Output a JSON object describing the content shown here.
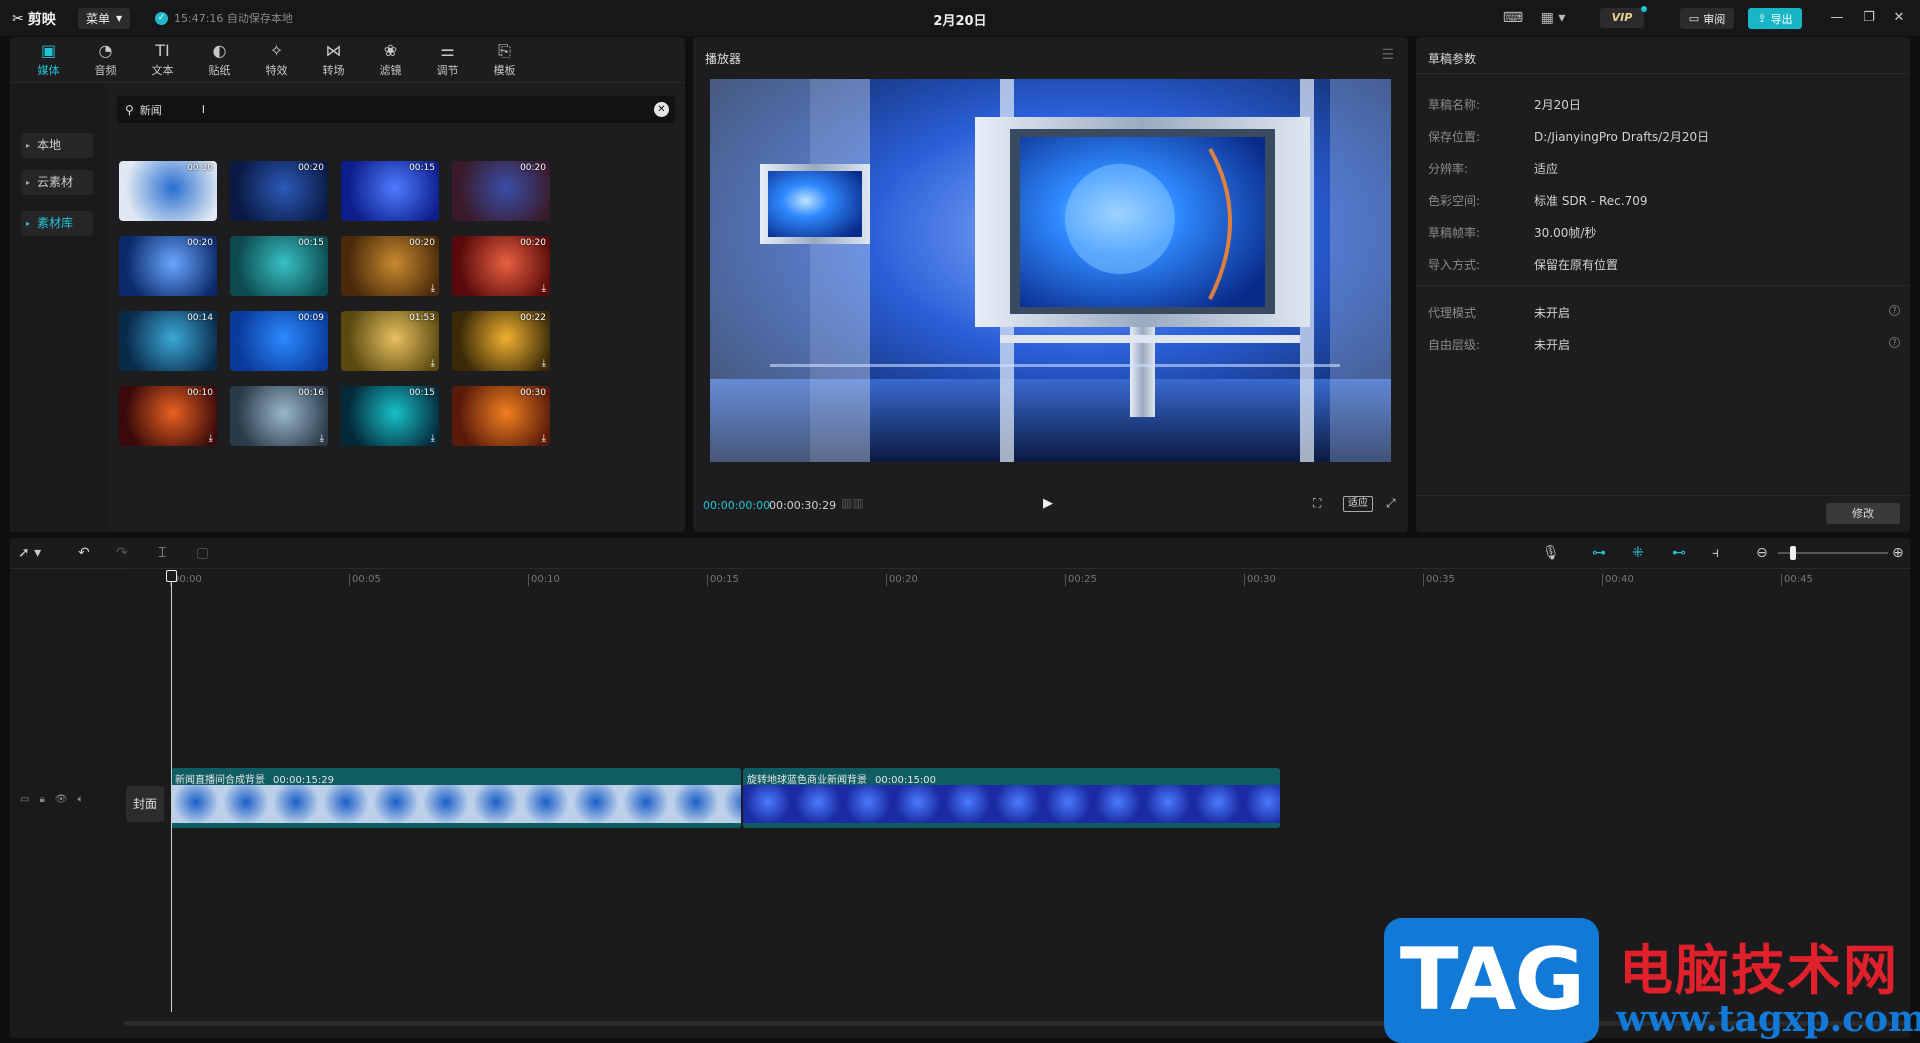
{
  "app": {
    "name": "剪映",
    "menu_label": "菜单",
    "autosave": "15:47:16 自动保存本地",
    "doc_title": "2月20日",
    "vip_label": "VIP",
    "review_label": "审阅",
    "export_label": "导出"
  },
  "media": {
    "tabs": [
      {
        "label": "媒体",
        "icon": "media-icon"
      },
      {
        "label": "音频",
        "icon": "audio-icon"
      },
      {
        "label": "文本",
        "icon": "text-icon"
      },
      {
        "label": "贴纸",
        "icon": "sticker-icon"
      },
      {
        "label": "特效",
        "icon": "effects-icon"
      },
      {
        "label": "转场",
        "icon": "transition-icon"
      },
      {
        "label": "滤镜",
        "icon": "filter-icon"
      },
      {
        "label": "调节",
        "icon": "adjust-icon"
      },
      {
        "label": "模板",
        "icon": "template-icon"
      }
    ],
    "sidebar": [
      {
        "label": "本地"
      },
      {
        "label": "云素材"
      },
      {
        "label": "素材库"
      }
    ],
    "search_value": "新闻",
    "thumbnails": [
      {
        "dur": "00:30",
        "download": false,
        "c1": "#dfe8f3",
        "c2": "#2a6fd0"
      },
      {
        "dur": "00:20",
        "download": false,
        "c1": "#0a1a44",
        "c2": "#2b5ab8"
      },
      {
        "dur": "00:15",
        "download": false,
        "c1": "#0d1d8a",
        "c2": "#4d7bff"
      },
      {
        "dur": "00:20",
        "download": false,
        "c1": "#3a1a2a",
        "c2": "#3a4fa8"
      },
      {
        "dur": "00:20",
        "download": false,
        "c1": "#0a2a6a",
        "c2": "#6aa6ff"
      },
      {
        "dur": "00:15",
        "download": false,
        "c1": "#0c4a4e",
        "c2": "#38c0c4"
      },
      {
        "dur": "00:20",
        "download": true,
        "c1": "#4a2a0a",
        "c2": "#c88a30"
      },
      {
        "dur": "00:20",
        "download": true,
        "c1": "#5a0a0a",
        "c2": "#e86040"
      },
      {
        "dur": "00:14",
        "download": false,
        "c1": "#0a2a4a",
        "c2": "#3aa8d8"
      },
      {
        "dur": "00:09",
        "download": false,
        "c1": "#0a3a9a",
        "c2": "#2a8aff"
      },
      {
        "dur": "01:53",
        "download": true,
        "c1": "#5a4a10",
        "c2": "#e8c060"
      },
      {
        "dur": "00:22",
        "download": true,
        "c1": "#3a2a08",
        "c2": "#f0b030"
      },
      {
        "dur": "00:10",
        "download": true,
        "c1": "#3a0a0a",
        "c2": "#e86020"
      },
      {
        "dur": "00:16",
        "download": true,
        "c1": "#2a3a4a",
        "c2": "#9ab8c8"
      },
      {
        "dur": "00:15",
        "download": true,
        "c1": "#042a3a",
        "c2": "#18c0c8"
      },
      {
        "dur": "00:30",
        "download": true,
        "c1": "#5a1a0a",
        "c2": "#f08020"
      }
    ]
  },
  "player": {
    "title": "播放器",
    "current_time": "00:00:00:00",
    "total_time": "00:00:30:29",
    "fit_label": "适应"
  },
  "props": {
    "title": "草稿参数",
    "rows": [
      {
        "label": "草稿名称:",
        "value": "2月20日"
      },
      {
        "label": "保存位置:",
        "value": "D:/JianyingPro Drafts/2月20日"
      },
      {
        "label": "分辨率:",
        "value": "适应"
      },
      {
        "label": "色彩空间:",
        "value": "标准 SDR - Rec.709"
      },
      {
        "label": "草稿帧率:",
        "value": "30.00帧/秒"
      },
      {
        "label": "导入方式:",
        "value": "保留在原有位置"
      }
    ],
    "rows2": [
      {
        "label": "代理模式",
        "value": "未开启"
      },
      {
        "label": "自由层级:",
        "value": "未开启"
      }
    ],
    "modify_label": "修改"
  },
  "timeline": {
    "ticks": [
      "00:00",
      "00:05",
      "00:10",
      "00:15",
      "00:20",
      "00:25",
      "00:30",
      "00:35",
      "00:40",
      "00:45"
    ],
    "cover_label": "封面",
    "clips": [
      {
        "name": "新闻直播间合成背景",
        "duration": "00:00:15:29",
        "c1": "#bcd0ea",
        "c2": "#1b5fc8"
      },
      {
        "name": "旋转地球蓝色商业新闻背景",
        "duration": "00:00:15:00",
        "c1": "#1a2aa0",
        "c2": "#4a7aff"
      }
    ]
  },
  "watermark": {
    "tag": "TAG",
    "cn": "电脑技术网",
    "url": "www.tagxp.com"
  }
}
